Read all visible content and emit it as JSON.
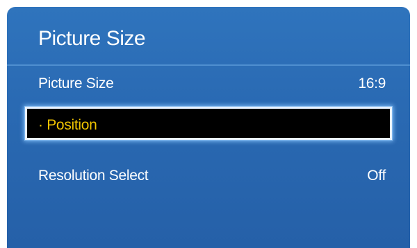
{
  "menu": {
    "title": "Picture Size",
    "items": [
      {
        "label": "Picture Size",
        "value": "16:9"
      },
      {
        "label": "· Position",
        "value": ""
      },
      {
        "label": "Resolution Select",
        "value": "Off"
      }
    ],
    "selected_index": 1
  },
  "colors": {
    "panel_background": "#2a6ab3",
    "selected_background": "#000000",
    "selected_text": "#f0c400",
    "text": "#ffffff"
  }
}
